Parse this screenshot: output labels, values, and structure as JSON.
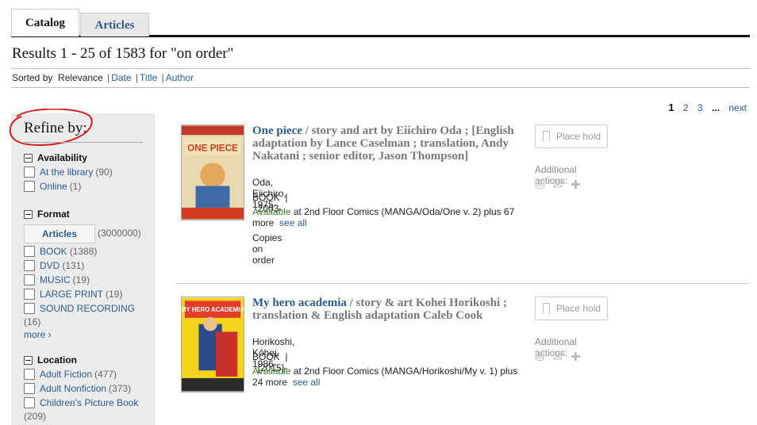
{
  "tabs": [
    "Catalog",
    "Articles"
  ],
  "results_title": "Results 1 - 25 of 1583 for \"on order\"",
  "sort": {
    "label": "Sorted by",
    "current": "Relevance",
    "options": [
      "Date",
      "Title",
      "Author"
    ]
  },
  "pager": {
    "pages": [
      "1",
      "2",
      "3"
    ],
    "ellipsis": "...",
    "next": "next"
  },
  "sidebar": {
    "title": "Refine by:",
    "availability": {
      "heading": "Availability",
      "items": [
        {
          "label": "At the library",
          "count": "(90)"
        },
        {
          "label": "Online",
          "count": "(1)"
        }
      ]
    },
    "format": {
      "heading": "Format",
      "articles_button": "Articles",
      "articles_count": "(3000000)",
      "items": [
        {
          "label": "BOOK",
          "count": "(1388)"
        },
        {
          "label": "DVD",
          "count": "(131)"
        },
        {
          "label": "MUSIC",
          "count": "(19)"
        },
        {
          "label": "LARGE PRINT",
          "count": "(19)"
        },
        {
          "label": "SOUND RECORDING",
          "count": "(16)"
        }
      ],
      "more": "more"
    },
    "location": {
      "heading": "Location",
      "items": [
        {
          "label": "Adult Fiction",
          "count": "(477)"
        },
        {
          "label": "Adult Nonfiction",
          "count": "(373)"
        },
        {
          "label": "Children's Picture Book",
          "count": "(209)"
        }
      ]
    }
  },
  "records": [
    {
      "title": "One piece",
      "rest": " / story and art by Eiichiro Oda ; [English adaptation by Lance Caselman ; translation, Andy Nakatani ; senior editor, Jason Thompson]",
      "author": "Oda, Eiichiro, 1975-",
      "format": "BOOK",
      "year": "2003-",
      "available": "Available",
      "location": " at 2nd Floor Comics (MANGA/Oda/One v. 2) plus 67",
      "more": "more",
      "see_all": "see all",
      "copies": "Copies on order",
      "hold": "Place hold",
      "additional": "Additional actions:"
    },
    {
      "title": "My hero academia",
      "rest": " / story & art Kohei Horikoshi ; translation & English adaptation Caleb Cook",
      "author": "Horikoshi, Kōhei, 1986-",
      "format": "BOOK",
      "year": "[2015]-",
      "available": "Available",
      "location": " at 2nd Floor Comics (MANGA/Horikoshi/My v. 1) plus",
      "more": "24 more",
      "see_all": "see all",
      "hold": "Place hold",
      "additional": "Additional actions:"
    }
  ],
  "cover_art": {
    "one_piece": "ONE PIECE",
    "mha": "MY HERO ACADEMIA"
  },
  "colors": {
    "link": "#2c5b8c",
    "available": "#3a7d2d",
    "annotation": "#d42020"
  }
}
